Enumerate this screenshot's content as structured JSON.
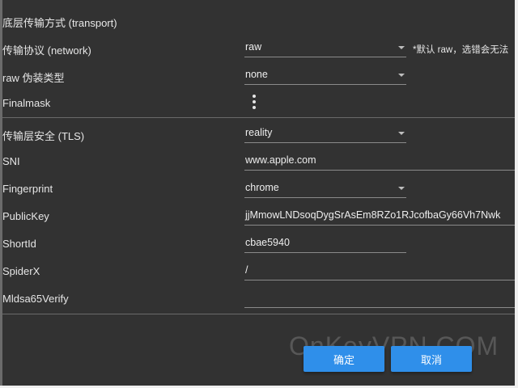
{
  "section_title": "底层传输方式 (transport)",
  "network": {
    "label": "传输协议 (network)",
    "value": "raw",
    "hint": "*默认 raw，选错会无法"
  },
  "raw_disguise": {
    "label": "raw 伪装类型",
    "value": "none"
  },
  "finalmask": {
    "label": "Finalmask",
    "menu_icon": "more-vertical-icon"
  },
  "tls": {
    "label": "传输层安全 (TLS)",
    "value": "reality"
  },
  "sni": {
    "label": "SNI",
    "value": "www.apple.com"
  },
  "fingerprint": {
    "label": "Fingerprint",
    "value": "chrome"
  },
  "public_key": {
    "label": "PublicKey",
    "value": "jjMmowLNDsoqDygSrAsEm8RZo1RJcofbaGy66Vh7Nwk"
  },
  "short_id": {
    "label": "ShortId",
    "value": "cbae5940"
  },
  "spider_x": {
    "label": "SpiderX",
    "value": "/"
  },
  "mldsa": {
    "label": "Mldsa65Verify",
    "value": ""
  },
  "buttons": {
    "confirm": "确定",
    "cancel": "取消"
  },
  "watermark": "OnKeyVPN.COM",
  "colors": {
    "accent": "#2f8fea",
    "background": "#323232",
    "text": "#e6e6e6"
  }
}
